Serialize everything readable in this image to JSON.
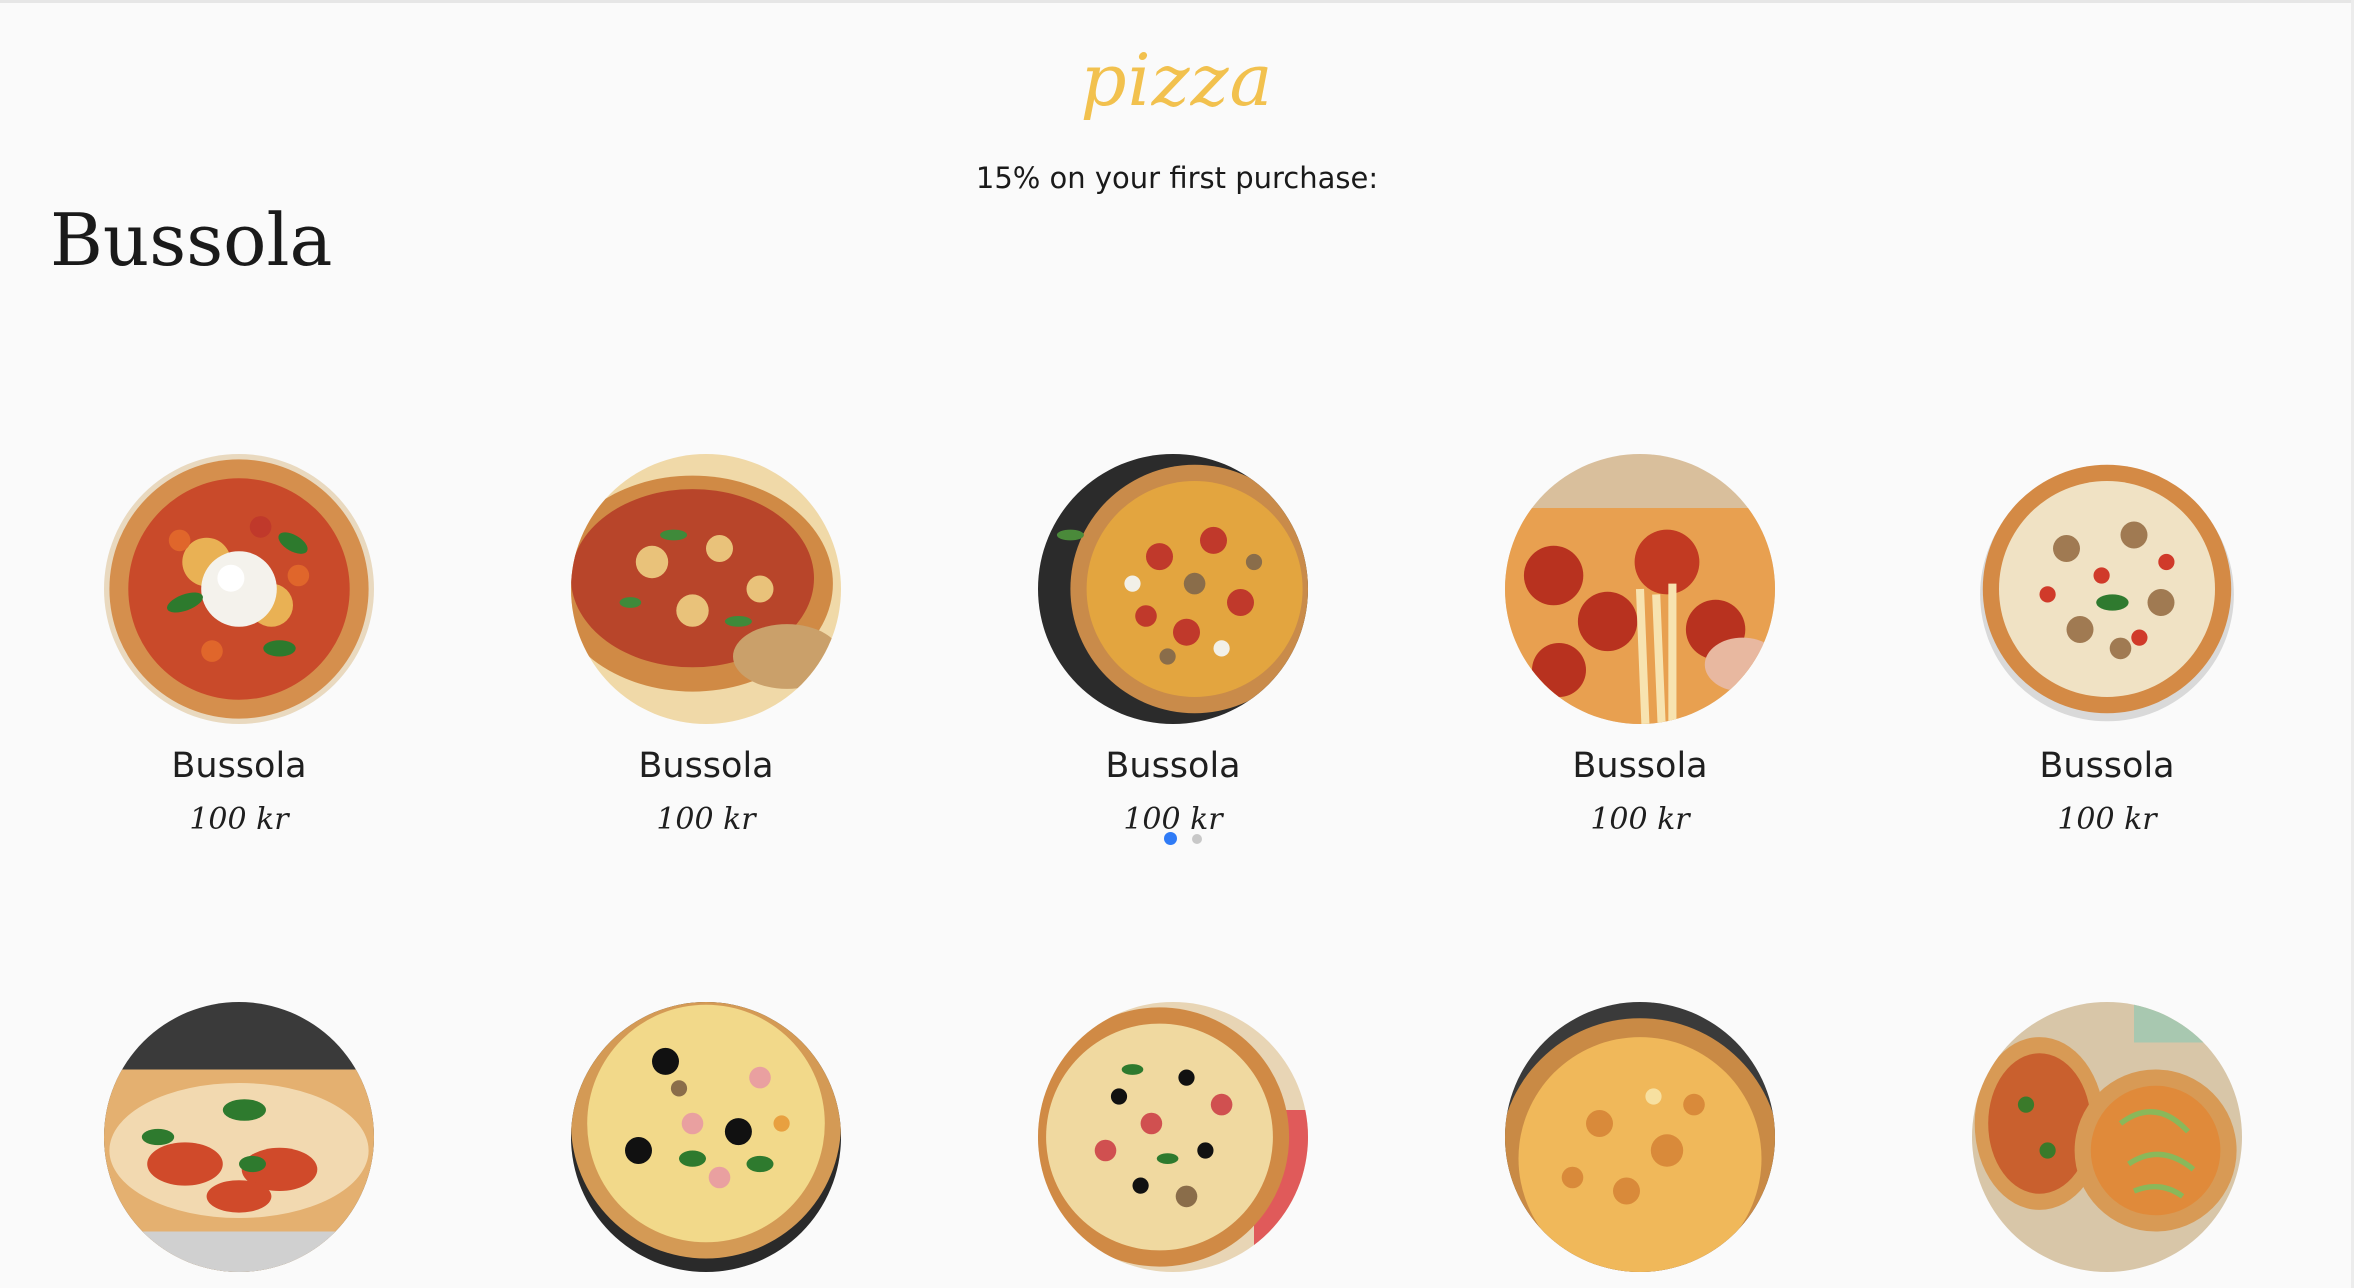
{
  "header": {
    "brand": "pizza",
    "promo": "15% on your first purchase:"
  },
  "shop": {
    "title": "Bussola"
  },
  "products": [
    {
      "name": "Bussola",
      "price": "100 kr"
    },
    {
      "name": "Bussola",
      "price": "100 kr"
    },
    {
      "name": "Bussola",
      "price": "100 kr"
    },
    {
      "name": "Bussola",
      "price": "100 kr"
    },
    {
      "name": "Bussola",
      "price": "100 kr"
    },
    {
      "name": "",
      "price": ""
    },
    {
      "name": "",
      "price": ""
    },
    {
      "name": "",
      "price": ""
    },
    {
      "name": "",
      "price": ""
    },
    {
      "name": "",
      "price": ""
    }
  ],
  "carousel": {
    "active_index": 0,
    "count": 2
  },
  "colors": {
    "brand": "#f2c14e",
    "background": "#fafafa",
    "dot_active": "#2f7bf6",
    "dot_inactive": "#c8c8c8"
  }
}
